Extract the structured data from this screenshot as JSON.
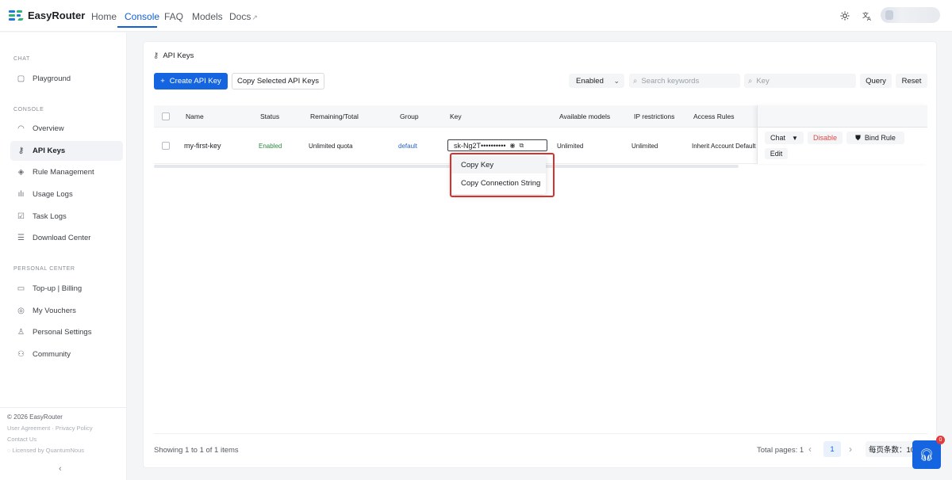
{
  "app": {
    "name": "EasyRouter",
    "nav": [
      {
        "label": "Home"
      },
      {
        "label": "Console"
      },
      {
        "label": "FAQ"
      },
      {
        "label": "Models"
      },
      {
        "label": "Docs"
      }
    ],
    "accent_color": "#1565e0"
  },
  "sidebar": {
    "chat_title": "CHAT",
    "console_title": "CONSOLE",
    "personal_title": "PERSONAL CENTER",
    "items": [
      {
        "label": "Playground",
        "icon": "playground-icon"
      },
      {
        "label": "Overview",
        "icon": "gauge-icon"
      },
      {
        "label": "API Keys",
        "icon": "key-icon"
      },
      {
        "label": "Rule Management",
        "icon": "shield-icon"
      },
      {
        "label": "Usage Logs",
        "icon": "bar-chart-icon"
      },
      {
        "label": "Task Logs",
        "icon": "checklist-icon"
      },
      {
        "label": "Download Center",
        "icon": "list-icon"
      },
      {
        "label": "Top-up | Billing",
        "icon": "card-icon"
      },
      {
        "label": "My Vouchers",
        "icon": "voucher-icon"
      },
      {
        "label": "Personal Settings",
        "icon": "user-icon"
      },
      {
        "label": "Community",
        "icon": "users-icon"
      }
    ],
    "footer": {
      "copyright": "© 2026 EasyRouter",
      "user_agreement": "User Agreement",
      "privacy_policy": "Privacy Policy",
      "contact": "Contact Us",
      "license": "Licensed by QuantumNous"
    }
  },
  "page": {
    "title": "API Keys",
    "create_button": "Create API Key",
    "copy_selected_button": "Copy Selected API Keys",
    "status_filter": "Enabled",
    "search_placeholder": "Search keywords",
    "key_placeholder": "Key",
    "query_button": "Query",
    "reset_button": "Reset"
  },
  "table": {
    "columns": [
      "Name",
      "Status",
      "Remaining/Total",
      "Group",
      "Key",
      "Available models",
      "IP restrictions",
      "Access Rules"
    ],
    "rows": [
      {
        "name": "my-first-key",
        "status": "Enabled",
        "remaining": "Unlimited quota",
        "group": "default",
        "key": "sk-Ng2T••••••••••",
        "models": "Unlimited",
        "ip": "Unlimited",
        "access_rules": "Inherit Account Default",
        "actions": {
          "chat": "Chat",
          "disable": "Disable",
          "bind_rule": "Bind Rule",
          "edit": "Edit"
        }
      }
    ]
  },
  "copy_menu": {
    "items": [
      "Copy Key",
      "Copy Connection String"
    ]
  },
  "pagination": {
    "showing": "Showing 1 to 1 of 1 items",
    "total_pages": "Total pages: 1",
    "current_page": "1",
    "per_page": "每页条数：10"
  },
  "support": {
    "badge": "0"
  }
}
